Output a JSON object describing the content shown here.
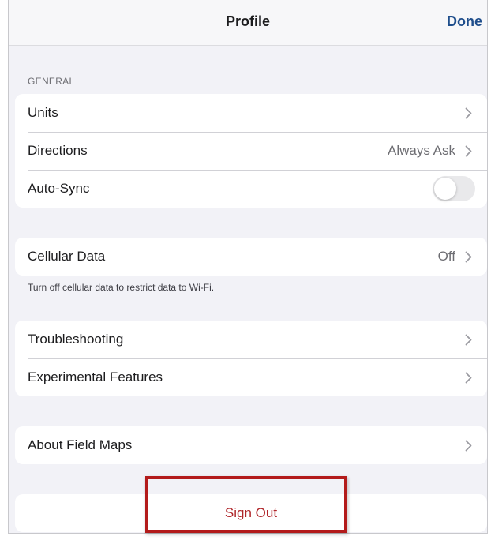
{
  "navbar": {
    "title": "Profile",
    "done_label": "Done"
  },
  "general": {
    "header": "GENERAL",
    "units_label": "Units",
    "directions_label": "Directions",
    "directions_value": "Always Ask",
    "autosync_label": "Auto-Sync",
    "autosync_on": false
  },
  "cellular": {
    "label": "Cellular Data",
    "value": "Off",
    "footnote": "Turn off cellular data to restrict data to Wi-Fi."
  },
  "support": {
    "troubleshooting_label": "Troubleshooting",
    "experimental_label": "Experimental Features"
  },
  "about": {
    "label": "About Field Maps"
  },
  "signout": {
    "label": "Sign Out"
  },
  "colors": {
    "accent": "#1f4e8c",
    "destructive": "#b0262a",
    "highlight": "#b31b1b",
    "background": "#f2f2f7"
  },
  "icons": {
    "disclosure": "chevron-right-icon"
  }
}
